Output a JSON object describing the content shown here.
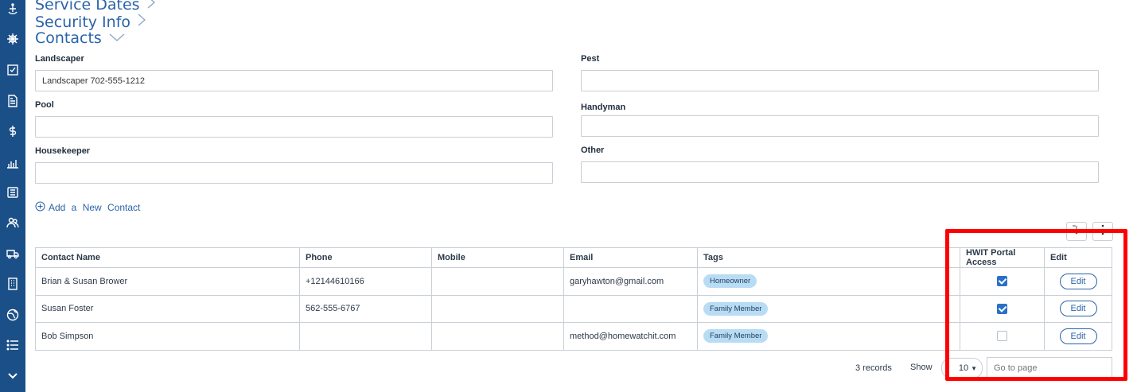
{
  "sections": {
    "service_dates": "Service Dates",
    "security_info": "Security Info",
    "contacts": "Contacts"
  },
  "sidebar": {
    "icons": [
      "ship-icon",
      "helm-icon",
      "checkbox-icon",
      "document-icon",
      "dollar-icon",
      "chart-icon",
      "list-icon",
      "people-icon",
      "truck-icon",
      "building-icon",
      "globe-icon",
      "menu-list-icon",
      "chevron-down-icon"
    ]
  },
  "contact_fields": {
    "landscaper": {
      "label": "Landscaper",
      "value": "Landscaper 702-555-1212"
    },
    "pest": {
      "label": "Pest",
      "value": ""
    },
    "pool": {
      "label": "Pool",
      "value": ""
    },
    "handyman": {
      "label": "Handyman",
      "value": ""
    },
    "housekeeper": {
      "label": "Housekeeper",
      "value": ""
    },
    "other": {
      "label": "Other",
      "value": ""
    }
  },
  "add_contact_label": "Add a New Contact",
  "table": {
    "headers": [
      "Contact Name",
      "Phone",
      "Mobile",
      "Email",
      "Tags",
      "HWIT Portal Access",
      "Edit"
    ],
    "rows": [
      {
        "name": "Brian & Susan Brower",
        "phone": "+12144610166",
        "mobile": "",
        "email": "garyhawton@gmail.com",
        "tag": "Homeowner",
        "portal_access": true,
        "edit": "Edit"
      },
      {
        "name": "Susan Foster",
        "phone": "562-555-6767",
        "mobile": "",
        "email": "",
        "tag": "Family Member",
        "portal_access": true,
        "edit": "Edit"
      },
      {
        "name": "Bob Simpson",
        "phone": "",
        "mobile": "",
        "email": "method@homewatchit.com",
        "tag": "Family Member",
        "portal_access": false,
        "edit": "Edit"
      }
    ]
  },
  "footer": {
    "records": "3 records",
    "show_label": "Show",
    "page_size": "10",
    "goto_placeholder": "Go to page"
  },
  "colors": {
    "sidebar": "#1b4f87",
    "link": "#2a63a8",
    "tag_bg": "#b9dcf5",
    "checkbox": "#2a70c8",
    "highlight": "#ff0000"
  }
}
